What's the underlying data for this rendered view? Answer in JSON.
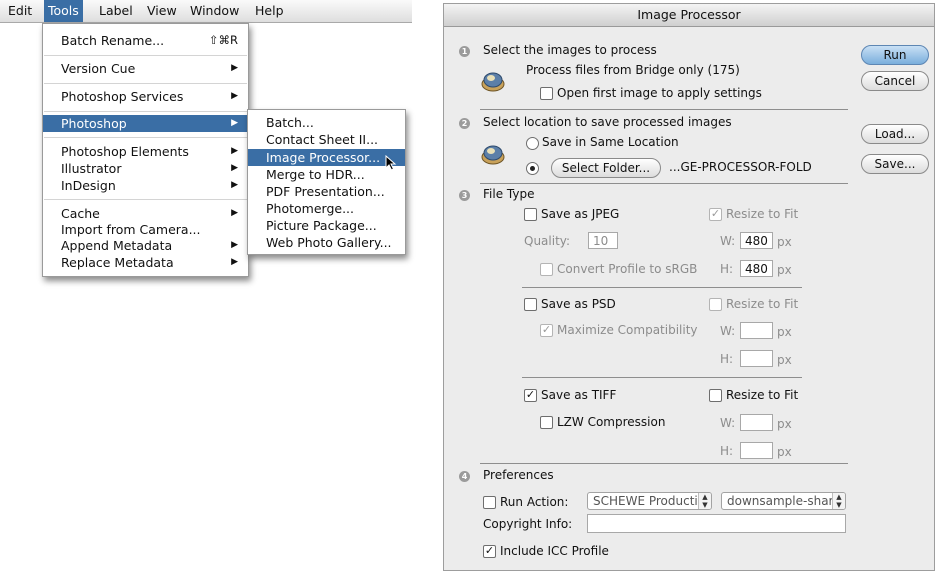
{
  "menubar": {
    "items": [
      {
        "label": "Edit"
      },
      {
        "label": "Tools"
      },
      {
        "label": "Label"
      },
      {
        "label": "View"
      },
      {
        "label": "Window"
      },
      {
        "label": "Help"
      }
    ]
  },
  "tools_menu": {
    "batch_rename": "Batch Rename...",
    "batch_rename_shortcut": "⇧⌘R",
    "version_cue": "Version Cue",
    "photoshop_services": "Photoshop Services",
    "photoshop": "Photoshop",
    "photoshop_elements": "Photoshop Elements",
    "illustrator": "Illustrator",
    "indesign": "InDesign",
    "cache": "Cache",
    "import_from_camera": "Import from Camera...",
    "append_metadata": "Append Metadata",
    "replace_metadata": "Replace Metadata"
  },
  "photoshop_submenu": {
    "batch": "Batch...",
    "contact_sheet": "Contact Sheet II...",
    "image_processor": "Image Processor...",
    "merge_to_hdr": "Merge to HDR...",
    "pdf_presentation": "PDF Presentation...",
    "photomerge": "Photomerge...",
    "picture_package": "Picture Package...",
    "web_photo_gallery": "Web Photo Gallery..."
  },
  "dialog": {
    "title": "Image Processor",
    "buttons": {
      "run": "Run",
      "cancel": "Cancel",
      "load": "Load...",
      "save": "Save..."
    },
    "section1": {
      "num": "1",
      "heading": "Select the images to process",
      "source": "Process files from Bridge only (175)",
      "open_first": "Open first image to apply settings",
      "open_first_checked": false
    },
    "section2": {
      "num": "2",
      "heading": "Select location to save processed images",
      "save_same": "Save in Same Location",
      "select_folder_btn": "Select Folder...",
      "folder_path": "...GE-PROCESSOR-FOLD",
      "selected_option": "select_folder"
    },
    "section3": {
      "num": "3",
      "heading": "File Type",
      "jpeg": {
        "label": "Save as JPEG",
        "checked": false,
        "resize": "Resize to Fit",
        "resize_checked": true,
        "quality_label": "Quality:",
        "quality": "10",
        "w_label": "W:",
        "w": "480",
        "h_label": "H:",
        "h": "480",
        "unit": "px",
        "convert": "Convert Profile to sRGB",
        "convert_checked": false
      },
      "psd": {
        "label": "Save as PSD",
        "checked": false,
        "resize": "Resize to Fit",
        "resize_checked": false,
        "maximize": "Maximize Compatibility",
        "maximize_checked": true,
        "w_label": "W:",
        "h_label": "H:",
        "unit": "px"
      },
      "tiff": {
        "label": "Save as TIFF",
        "checked": true,
        "resize": "Resize to Fit",
        "resize_checked": false,
        "lzw": "LZW Compression",
        "lzw_checked": false,
        "w_label": "W:",
        "h_label": "H:",
        "unit": "px"
      }
    },
    "section4": {
      "num": "4",
      "heading": "Preferences",
      "run_action": "Run Action:",
      "run_action_checked": false,
      "action_set": "SCHEWE Productio",
      "action_name": "downsample-shar",
      "copyright_label": "Copyright Info:",
      "copyright_value": "",
      "include_icc": "Include ICC Profile",
      "include_icc_checked": true
    }
  },
  "colors": {
    "highlight": "#3a6ea5",
    "dialog_bg": "#ececec",
    "default_button": "#7aaedc"
  },
  "icons": [
    "bridge-icon",
    "submenu-arrow-icon",
    "mouse-cursor-icon",
    "checkmark-icon",
    "popup-arrows-icon"
  ]
}
